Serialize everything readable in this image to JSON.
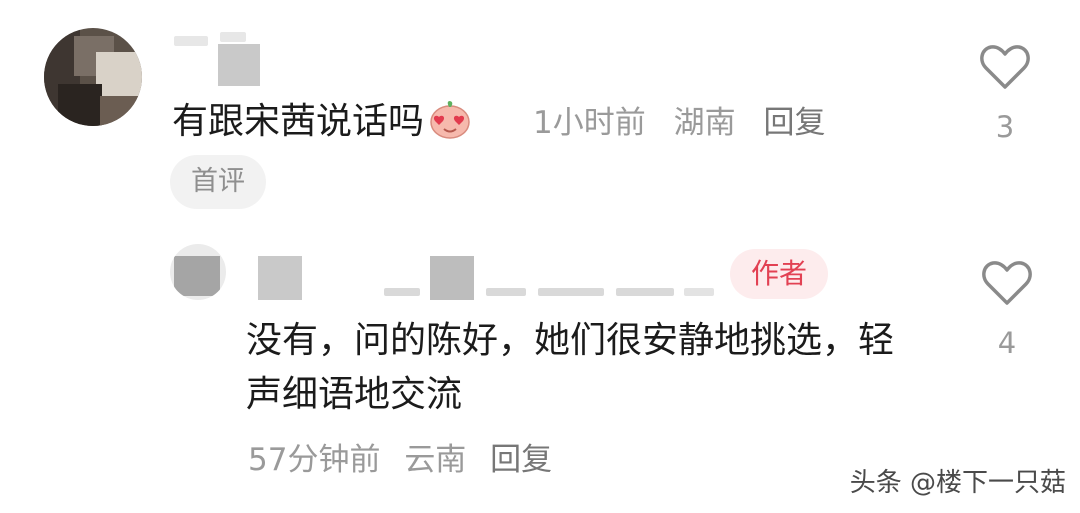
{
  "comment": {
    "text": "有跟宋茜说话吗",
    "emoji_icon": "heart-eyes-face-icon",
    "time": "1小时前",
    "location": "湖南",
    "reply_label": "回复",
    "tag": "首评",
    "like_count": "3"
  },
  "reply": {
    "author_badge": "作者",
    "text": "没有，问的陈好，她们很安静地挑选，轻声细语地交流",
    "time": "57分钟前",
    "location": "云南",
    "reply_label": "回复",
    "like_count": "4"
  },
  "watermark": "头条 @楼下一只菇",
  "colors": {
    "author_badge_bg": "#fdeced",
    "author_badge_text": "#e24153",
    "meta_text": "#9a9a9a"
  }
}
